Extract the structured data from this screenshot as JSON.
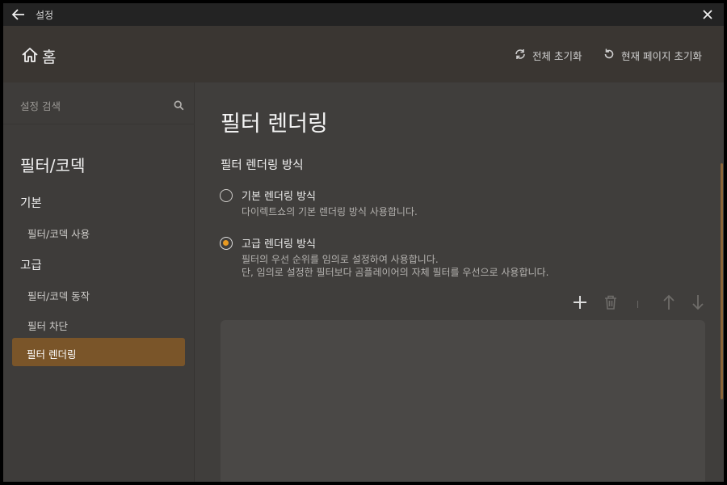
{
  "titlebar": {
    "title": "설정"
  },
  "header": {
    "home_label": "홈",
    "reset_all_label": "전체 초기화",
    "reset_page_label": "현재 페이지 초기화"
  },
  "sidebar": {
    "search_placeholder": "설정 검색",
    "category": "필터/코덱",
    "groups": [
      {
        "label": "기본",
        "items": [
          "필터/코덱 사용"
        ]
      },
      {
        "label": "고급",
        "items": [
          "필터/코덱 동작",
          "필터 차단",
          "필터 렌더링"
        ]
      }
    ],
    "active_item": "필터 렌더링"
  },
  "main": {
    "page_title": "필터 렌더링",
    "section_title": "필터 렌더링 방식",
    "options": [
      {
        "label": "기본 렌더링 방식",
        "selected": false,
        "description": [
          "다이렉트쇼의 기본 렌더링 방식 사용합니다."
        ]
      },
      {
        "label": "고급 렌더링 방식",
        "selected": true,
        "description": [
          "필터의 우선 순위를 임의로 설정하여 사용합니다.",
          "단, 임의로 설정한 필터보다 곰플레이어의 자체 필터를 우선으로 사용합니다."
        ]
      }
    ],
    "toolbar": [
      "plus-icon",
      "trash-icon",
      "arrow-up-icon",
      "arrow-down-icon"
    ]
  },
  "colors": {
    "accent": "#e89a22",
    "active_item_bg": "#7a5529",
    "background": "#403e3c",
    "header_bg": "#3a3632"
  }
}
